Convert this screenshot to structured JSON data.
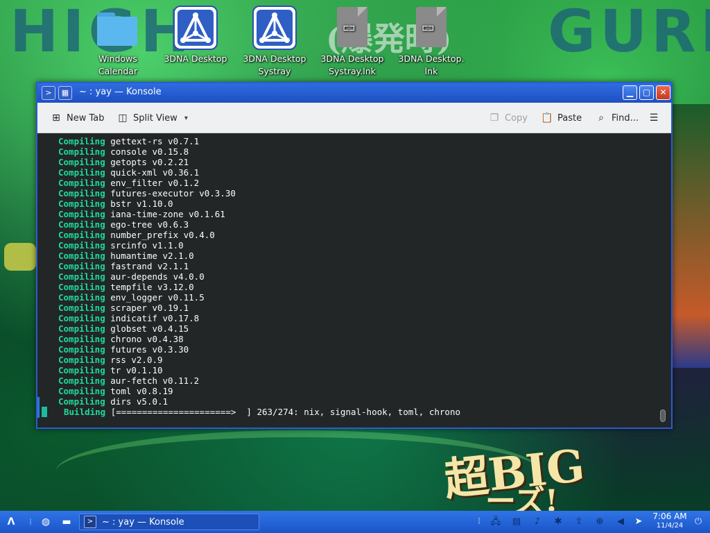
{
  "desktop_icons": [
    {
      "label": "Windows\nCalendar",
      "icon": "folder-icon"
    },
    {
      "label": "3DNA Desktop",
      "icon": "3dna-app-icon"
    },
    {
      "label": "3DNA Desktop\nSystray",
      "icon": "3dna-app-icon"
    },
    {
      "label": "3DNA Desktop\nSystray.lnk",
      "icon": "shortcut-file-icon"
    },
    {
      "label": "3DNA Desktop.\nlnk",
      "icon": "shortcut-file-icon"
    }
  ],
  "window": {
    "title": "~ : yay — Konsole",
    "toolbar": {
      "new_tab": "New Tab",
      "split_view": "Split View",
      "copy": "Copy",
      "paste": "Paste",
      "find": "Find..."
    }
  },
  "terminal": {
    "lines": [
      {
        "kw": "Compiling",
        "text": "gettext-rs v0.7.1"
      },
      {
        "kw": "Compiling",
        "text": "console v0.15.8"
      },
      {
        "kw": "Compiling",
        "text": "getopts v0.2.21"
      },
      {
        "kw": "Compiling",
        "text": "quick-xml v0.36.1"
      },
      {
        "kw": "Compiling",
        "text": "env_filter v0.1.2"
      },
      {
        "kw": "Compiling",
        "text": "futures-executor v0.3.30"
      },
      {
        "kw": "Compiling",
        "text": "bstr v1.10.0"
      },
      {
        "kw": "Compiling",
        "text": "iana-time-zone v0.1.61"
      },
      {
        "kw": "Compiling",
        "text": "ego-tree v0.6.3"
      },
      {
        "kw": "Compiling",
        "text": "number_prefix v0.4.0"
      },
      {
        "kw": "Compiling",
        "text": "srcinfo v1.1.0"
      },
      {
        "kw": "Compiling",
        "text": "humantime v2.1.0"
      },
      {
        "kw": "Compiling",
        "text": "fastrand v2.1.1"
      },
      {
        "kw": "Compiling",
        "text": "aur-depends v4.0.0"
      },
      {
        "kw": "Compiling",
        "text": "tempfile v3.12.0"
      },
      {
        "kw": "Compiling",
        "text": "env_logger v0.11.5"
      },
      {
        "kw": "Compiling",
        "text": "scraper v0.19.1"
      },
      {
        "kw": "Compiling",
        "text": "indicatif v0.17.8"
      },
      {
        "kw": "Compiling",
        "text": "globset v0.4.15"
      },
      {
        "kw": "Compiling",
        "text": "chrono v0.4.38"
      },
      {
        "kw": "Compiling",
        "text": "futures v0.3.30"
      },
      {
        "kw": "Compiling",
        "text": "rss v2.0.9"
      },
      {
        "kw": "Compiling",
        "text": "tr v0.1.10"
      },
      {
        "kw": "Compiling",
        "text": "aur-fetch v0.11.2"
      },
      {
        "kw": "Compiling",
        "text": "toml v0.8.19"
      },
      {
        "kw": "Compiling",
        "text": "dirs v5.0.1"
      }
    ],
    "status": {
      "kw": "Building",
      "bar": "[======================>  ]",
      "progress": "263/274:",
      "crates": "nix, signal-hook, toml, chrono"
    }
  },
  "taskbar": {
    "task_label": "~ : yay — Konsole",
    "clock_time": "7:06 AM",
    "clock_date": "11/4/24"
  },
  "wallpaper": {
    "top_text": "HIGH",
    "top_text_right": "GURE",
    "jp_text": "(爆発時)",
    "promo_text": "超BIG",
    "promo_text2": "ーズ!"
  },
  "colors": {
    "accent": "#2b5bd6",
    "terminal_bg": "#232627",
    "keyword": "#1cdc9a"
  }
}
